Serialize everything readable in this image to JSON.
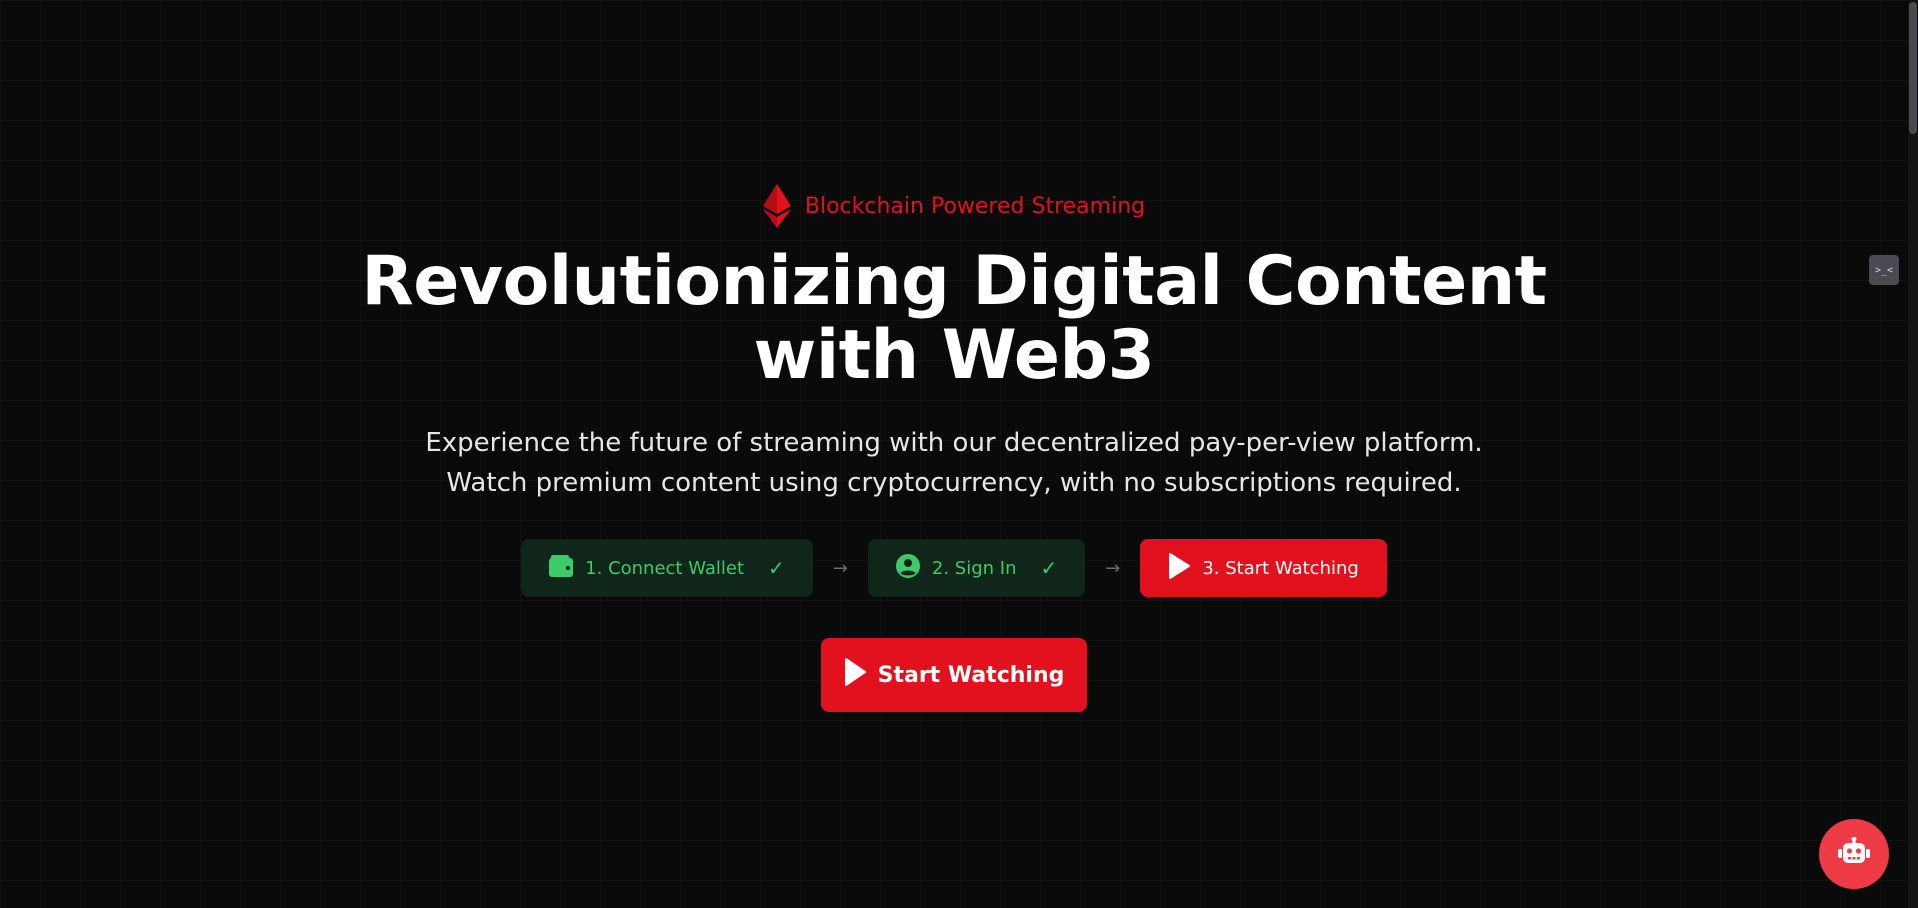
{
  "hero": {
    "badge": {
      "icon": "ethereum-icon",
      "text": "Blockchain Powered Streaming"
    },
    "headline_line1": "Revolutionizing Digital Content",
    "headline_line2": "with Web3",
    "subtitle_line1": "Experience the future of streaming with our decentralized pay-per-view platform.",
    "subtitle_line2": "Watch premium content using cryptocurrency, with no subscriptions required."
  },
  "steps": [
    {
      "icon": "wallet-icon",
      "label": "1. Connect Wallet",
      "status": "completed",
      "check": "✓"
    },
    {
      "icon": "user-circle-icon",
      "label": "2. Sign In",
      "status": "completed",
      "check": "✓"
    },
    {
      "icon": "play-icon",
      "label": "3. Start Watching",
      "status": "active"
    }
  ],
  "step_separator": "→",
  "cta": {
    "icon": "play-icon",
    "label": "Start Watching"
  },
  "floating": {
    "extension_widget_text": ">_<",
    "chatbot_icon": "robot-icon"
  },
  "colors": {
    "accent": "#e3111d",
    "success": "#3ec96a",
    "success_bg": "#10261a",
    "background": "#0a0a0b",
    "chatbot": "#ef3b45"
  }
}
